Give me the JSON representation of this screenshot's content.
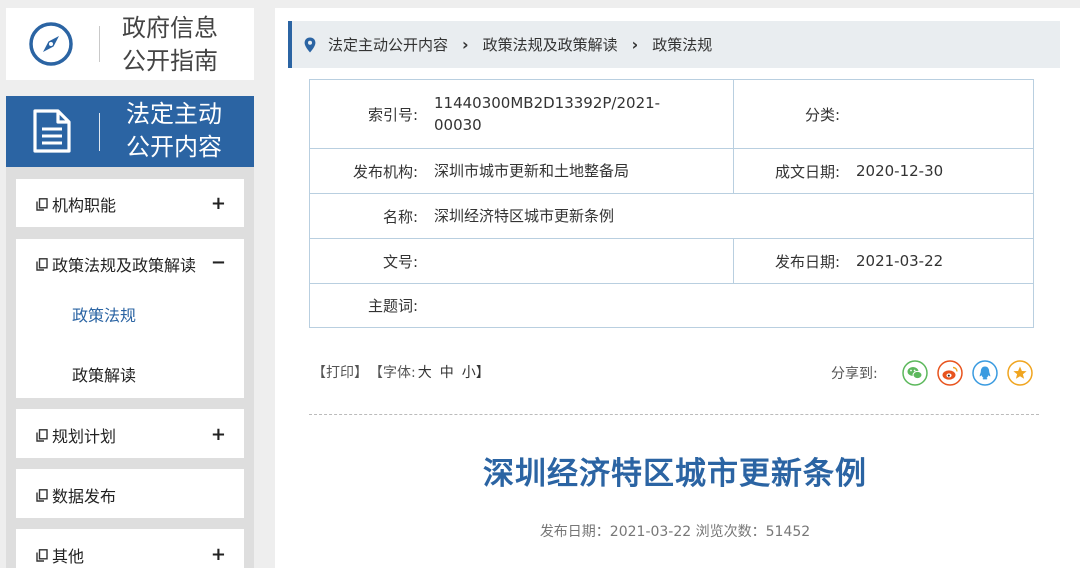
{
  "sidebar": {
    "guide_line1": "政府信息",
    "guide_line2": "公开指南",
    "active_line1": "法定主动",
    "active_line2": "公开内容",
    "items": [
      {
        "label": "机构职能",
        "toggle": "+"
      },
      {
        "label": "政策法规及政策解读",
        "toggle": "−",
        "children": [
          {
            "label": "政策法规"
          },
          {
            "label": "政策解读"
          }
        ]
      },
      {
        "label": "规划计划",
        "toggle": "+"
      },
      {
        "label": "数据发布",
        "toggle": ""
      },
      {
        "label": "其他",
        "toggle": "+"
      }
    ]
  },
  "breadcrumb": [
    "法定主动公开内容",
    "政策法规及政策解读",
    "政策法规"
  ],
  "meta": {
    "index_label": "索引号:",
    "index_value": "11440300MB2D13392P/2021-00030",
    "category_label": "分类:",
    "category_value": "",
    "org_label": "发布机构:",
    "org_value": "深圳市城市更新和土地整备局",
    "written_label": "成文日期:",
    "written_value": "2020-12-30",
    "name_label": "名称:",
    "name_value": "深圳经济特区城市更新条例",
    "docno_label": "文号:",
    "docno_value": "",
    "pub_label": "发布日期:",
    "pub_value": "2021-03-22",
    "keywords_label": "主题词:",
    "keywords_value": ""
  },
  "tools": {
    "print": "【打印】",
    "font_prefix": "【字体:",
    "font_large": "大",
    "font_medium": "中",
    "font_small": "小】",
    "share_label": "分享到:"
  },
  "article": {
    "title": "深圳经济特区城市更新条例",
    "info": "发布日期：2021-03-22  浏览次数：51452"
  },
  "colors": {
    "brand_blue": "#2b64a3",
    "wechat": "#5cb85c",
    "weibo": "#e8541e",
    "qq": "#3a9be0",
    "favorite": "#f0a520"
  }
}
